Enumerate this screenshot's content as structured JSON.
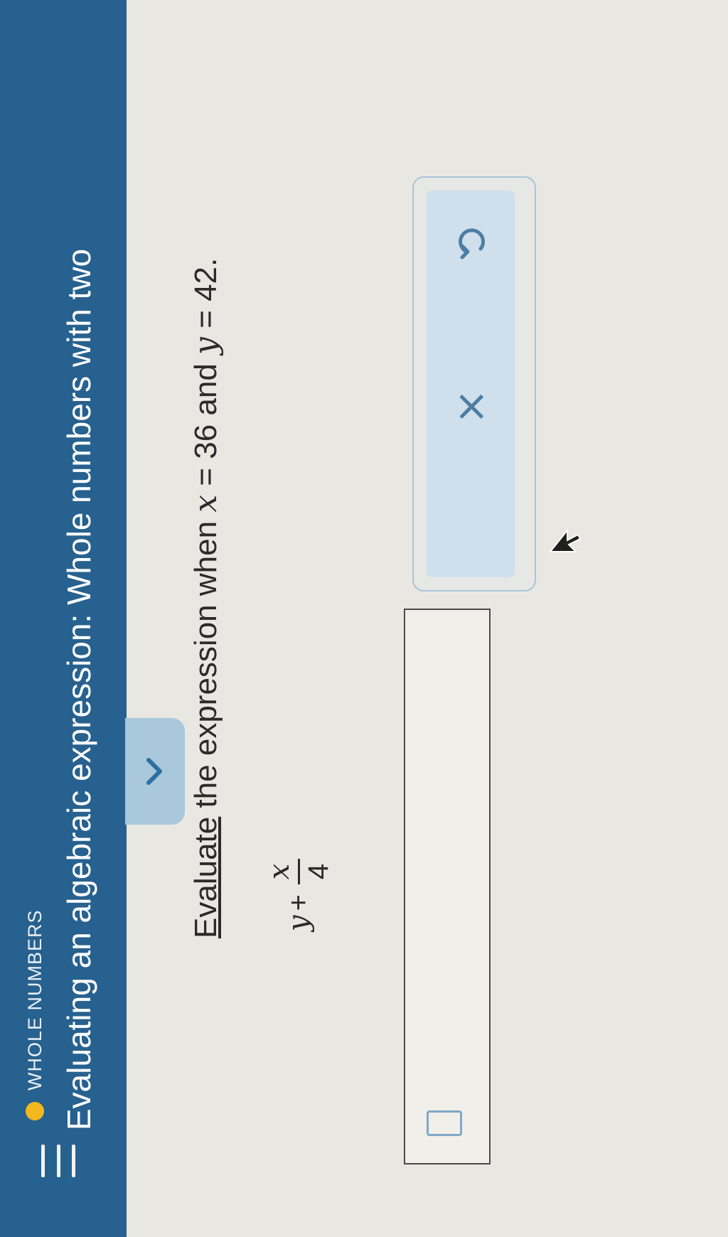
{
  "header": {
    "menu_icon": "hamburger-menu-icon",
    "topic_label": "WHOLE NUMBERS",
    "lesson_title": "Evaluating an algebraic expression: Whole numbers with two",
    "topic_dot_color": "#f2b81e",
    "background_color": "#27618f"
  },
  "collapse": {
    "icon": "chevron-down-icon"
  },
  "problem": {
    "verb": "Evaluate",
    "text_1": " the expression when ",
    "x_var": "x",
    "eq_1": " = 36 and ",
    "y_var": "y",
    "eq_2": " = 42."
  },
  "expression": {
    "y": "y",
    "plus": "+",
    "numerator": "x",
    "denominator": "4"
  },
  "answer": {
    "value": ""
  },
  "actions": {
    "clear_label": "×",
    "undo_icon": "undo-icon"
  }
}
